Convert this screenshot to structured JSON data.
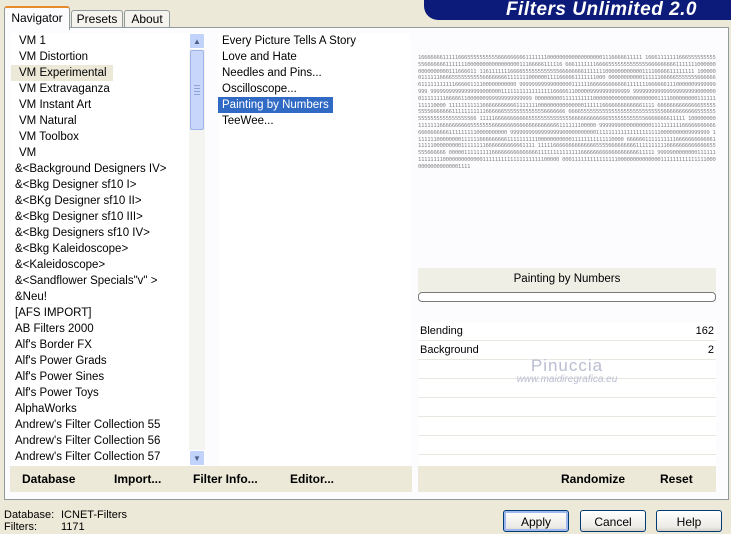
{
  "tabs": [
    {
      "label": "Navigator"
    },
    {
      "label": "Presets"
    },
    {
      "label": "About"
    }
  ],
  "banner_title": "Filters Unlimited 2.0",
  "categories": [
    "VM 1",
    "VM Distortion",
    "VM Experimental",
    "VM Extravaganza",
    "VM Instant Art",
    "VM Natural",
    "VM Toolbox",
    "VM",
    "&<Background Designers IV>",
    "&<Bkg Designer sf10 I>",
    "&<BKg Designer sf10 II>",
    "&<Bkg Designer sf10 III>",
    "&<Bkg Designers sf10 IV>",
    "&<Bkg Kaleidoscope>",
    "&<Kaleidoscope>",
    "&<Sandflower Specials\"v\" >",
    "&Neu!",
    "[AFS IMPORT]",
    "AB Filters 2000",
    "Alf's Border FX",
    "Alf's Power Grads",
    "Alf's Power Sines",
    "Alf's Power Toys",
    "AlphaWorks",
    "Andrew's Filter Collection 55",
    "Andrew's Filter Collection 56",
    "Andrew's Filter Collection 57"
  ],
  "selected_category": "VM Experimental",
  "filters": [
    "Every Picture Tells A Story",
    "Love and Hate",
    "Needles and Pins...",
    "Oscilloscope...",
    "Painting by Numbers",
    "TeeWee..."
  ],
  "selected_filter": "Painting by Numbers",
  "preview_text": "1666666611111666555555555566666666611111110000000000000000001116666611111 1666111111166655555555555666666611111110000000000000000011166666111116 66611111116666555555555555566666666611111110000000000000000111666611 1161111111666655555555555566666666111111100000000000011116666611111111 1000000111111666655555555556666666611111110000001111666661111111000 0000000000011111166666555555566666661111111111166666111100000000000 9999999999900000011111166666666666611111116666661110000009999999999 99999999999999999000000111111111111111116666611000009999999999999 9999999999999999999990000000111111116666611000000999999999999999 00000000011111111110000000000000000000001111000000000111111111110000 1111111111166666666666111111100000000000000011111166666666666661111 6666666666666655555555566666661111111111166666655555555555556666666 6666555555555555555555555555555666666666665555555555555555555555566 1111166666666666555555555555556666666666665555555555556666666611111 1000000001111111666666666655555556666666666666666666666111111100000 9999999000000000011111111116666666666666666666661111111110000000000 99999999999999999000000000001111111111111111111110000000009999999 11111110000000011111166666666611111111110000000000011111111111110000 6666661111111111666666666666111111000000000111111116666666666661111 1111166666666666666555566666666611111111116666666666666655555666666 0000011111111166666666666666611111111111111666666666666666666611111 99999000000001111111111111100000000000001111111111111111111100000 0001111111111111110000000000000011111111111111100000000000000001111",
  "filter_name_label": "Painting by Numbers",
  "params": [
    {
      "label": "Blending",
      "value": "162"
    },
    {
      "label": "Background",
      "value": "2"
    }
  ],
  "watermark": {
    "line1": "Pinuccia",
    "line2": "www.maidiregrafica.eu"
  },
  "links": {
    "database": "Database",
    "import": "Import...",
    "filter_info": "Filter Info...",
    "editor": "Editor...",
    "randomize": "Randomize",
    "reset": "Reset"
  },
  "status": {
    "database_label": "Database:",
    "database_value": "ICNET-Filters",
    "filters_label": "Filters:",
    "filters_value": "1171"
  },
  "buttons": {
    "apply": "Apply",
    "cancel": "Cancel",
    "help": "Help"
  },
  "colors": {
    "selection": "#316ac5",
    "banner": "#0c1a7a",
    "dialog": "#ece9d8"
  }
}
